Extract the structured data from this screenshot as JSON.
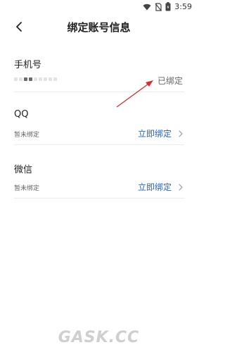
{
  "status_bar": {
    "time": "3:59",
    "icons": [
      "wifi-icon",
      "no-sim-icon",
      "battery-icon"
    ]
  },
  "header": {
    "title": "绑定账号信息",
    "back_icon": "chevron-left-icon"
  },
  "sections": [
    {
      "label": "手机号",
      "status": "已绑定"
    },
    {
      "label": "QQ",
      "sub_text": "暂未绑定",
      "action": "立即绑定"
    },
    {
      "label": "微信",
      "sub_text": "暂未绑定",
      "action": "立即绑定"
    }
  ],
  "colors": {
    "accent": "#2a60c9",
    "annotation_arrow": "#d32f2f",
    "divider": "#ececec"
  },
  "watermark": "GASK.CC"
}
